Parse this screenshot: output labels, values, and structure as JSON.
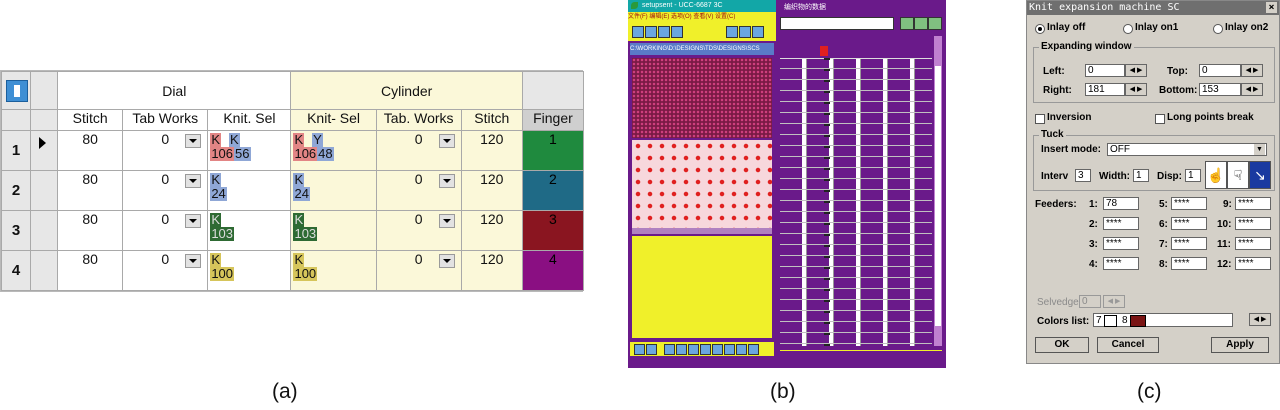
{
  "captions": {
    "a": "(a)",
    "b": "(b)",
    "c": "(c)"
  },
  "panelA": {
    "group_dial": "Dial",
    "group_cylinder": "Cylinder",
    "columns": [
      "Stitch",
      "Tab Works",
      "Knit. Sel",
      "Knit- Sel",
      "Tab. Works",
      "Stitch",
      "Finger"
    ],
    "rows": [
      {
        "num": "1",
        "stitch_d": "80",
        "tab_d": "0",
        "knit_d_top": "K   K",
        "knit_d_bot1": "106",
        "knit_d_bot2": "56",
        "knit_c_top": "K   Y",
        "knit_c_bot1": "106",
        "knit_c_bot2": "48",
        "tab_c": "0",
        "stitch_c": "120",
        "finger": "1"
      },
      {
        "num": "2",
        "stitch_d": "80",
        "tab_d": "0",
        "knit_d_top": "K",
        "knit_d_bot1": "24",
        "knit_d_bot2": "",
        "knit_c_top": "K",
        "knit_c_bot1": "24",
        "knit_c_bot2": "",
        "tab_c": "0",
        "stitch_c": "120",
        "finger": "2"
      },
      {
        "num": "3",
        "stitch_d": "80",
        "tab_d": "0",
        "knit_d_top": "K",
        "knit_d_bot1": "103",
        "knit_d_bot2": "",
        "knit_c_top": "K",
        "knit_c_bot1": "103",
        "knit_c_bot2": "",
        "tab_c": "0",
        "stitch_c": "120",
        "finger": "3"
      },
      {
        "num": "4",
        "stitch_d": "80",
        "tab_d": "0",
        "knit_d_top": "K",
        "knit_d_bot1": "100",
        "knit_d_bot2": "",
        "knit_c_top": "K",
        "knit_c_bot1": "100",
        "knit_c_bot2": "",
        "tab_c": "0",
        "stitch_c": "120",
        "finger": "4"
      }
    ],
    "colors": {
      "finger1": "#1f8a3e",
      "finger2": "#1f6a86",
      "finger3": "#8a1520",
      "finger4": "#8a0f82",
      "knit_red": "#e28585",
      "knit_blue": "#8fa7d6",
      "knit_green": "#2e6a33",
      "knit_yellow": "#d6c55b"
    }
  },
  "panelB": {
    "left_title": "setupsent - UCC-6687 3C",
    "right_title": "编织物的数据",
    "path_text": "C:\\WORKING\\D:\\DESIGNS\\TDS\\DESIGNS\\SCS",
    "menu_text": "文件(F) 编辑(E) 选项(O) 查看(V) 设置(C)",
    "colors": {
      "purple": "#6a1a8a",
      "yellow": "#f0f02a",
      "red": "#e02020",
      "pink": "#f7d7dc"
    }
  },
  "panelC": {
    "title": "Knit expansion machine SC",
    "radio_inlay_off": "Inlay off",
    "radio_inlay_on1": "Inlay on1",
    "radio_inlay_on2": "Inlay on2",
    "group_expanding": "Expanding window",
    "left_label": "Left:",
    "left_value": "0",
    "top_label": "Top:",
    "top_value": "0",
    "right_label": "Right:",
    "right_value": "181",
    "bottom_label": "Bottom:",
    "bottom_value": "153",
    "inversion": "Inversion",
    "long_points": "Long points break",
    "group_tuck": "Tuck",
    "insert_mode_label": "Insert mode:",
    "insert_mode_value": "OFF",
    "interv_label": "Interv",
    "interv_value": "3",
    "width_label": "Width:",
    "width_value": "1",
    "disp_label": "Disp:",
    "disp_value": "1",
    "feeders_label": "Feeders:",
    "feeders": [
      {
        "label": "1:",
        "value": "78"
      },
      {
        "label": "5:",
        "value": "****"
      },
      {
        "label": "9:",
        "value": "****"
      },
      {
        "label": "2:",
        "value": "****"
      },
      {
        "label": "6:",
        "value": "****"
      },
      {
        "label": "10:",
        "value": "****"
      },
      {
        "label": "3:",
        "value": "****"
      },
      {
        "label": "7:",
        "value": "****"
      },
      {
        "label": "11:",
        "value": "****"
      },
      {
        "label": "4:",
        "value": "****"
      },
      {
        "label": "8:",
        "value": "****"
      },
      {
        "label": "12:",
        "value": "****"
      }
    ],
    "selvedge_label": "Selvedge",
    "selvedge_value": "0",
    "colors_list_label": "Colors list:",
    "color_num1": "7",
    "color_num2": "8",
    "ok": "OK",
    "cancel": "Cancel",
    "apply": "Apply",
    "colors": {
      "swatch2": "#7a1414"
    }
  }
}
